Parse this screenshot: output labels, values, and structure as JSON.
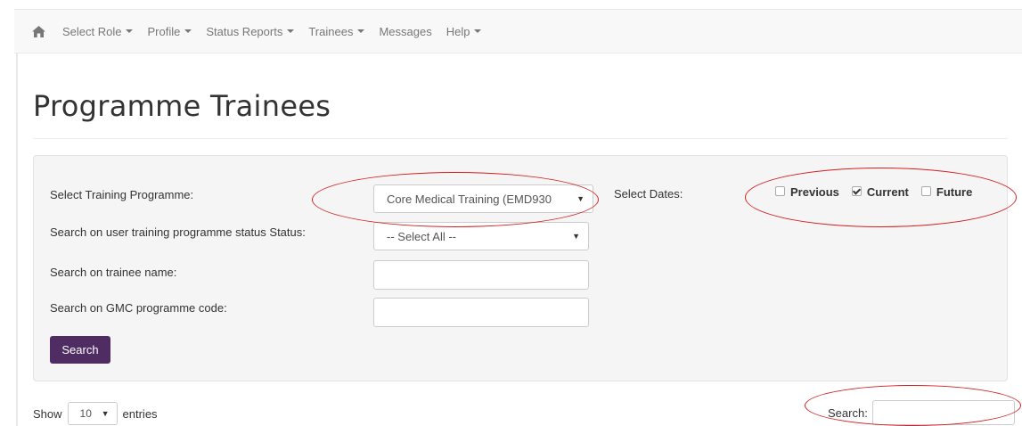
{
  "navbar": {
    "home_icon": "home-icon",
    "items": [
      {
        "label": "Select Role",
        "dropdown": true
      },
      {
        "label": "Profile",
        "dropdown": true
      },
      {
        "label": "Status Reports",
        "dropdown": true
      },
      {
        "label": "Trainees",
        "dropdown": true
      },
      {
        "label": "Messages",
        "dropdown": false
      },
      {
        "label": "Help",
        "dropdown": true
      }
    ]
  },
  "page_title": "Programme Trainees",
  "filters": {
    "programme_label": "Select Training Programme:",
    "programme_value": "Core Medical Training (EMD930",
    "status_label": "Search on user training programme status Status:",
    "status_value": "-- Select All --",
    "name_label": "Search on trainee name:",
    "name_value": "",
    "gmc_label": "Search on GMC programme code:",
    "gmc_value": "",
    "search_button": "Search",
    "dates_label": "Select Dates:",
    "dates": [
      {
        "label": "Previous",
        "checked": false
      },
      {
        "label": "Current",
        "checked": true
      },
      {
        "label": "Future",
        "checked": false
      }
    ]
  },
  "table_controls": {
    "show_prefix": "Show",
    "show_value": "10",
    "show_suffix": "entries",
    "search_label": "Search:",
    "search_value": ""
  },
  "colors": {
    "brand_button": "#4f2d63",
    "annotation": "#d42020"
  }
}
